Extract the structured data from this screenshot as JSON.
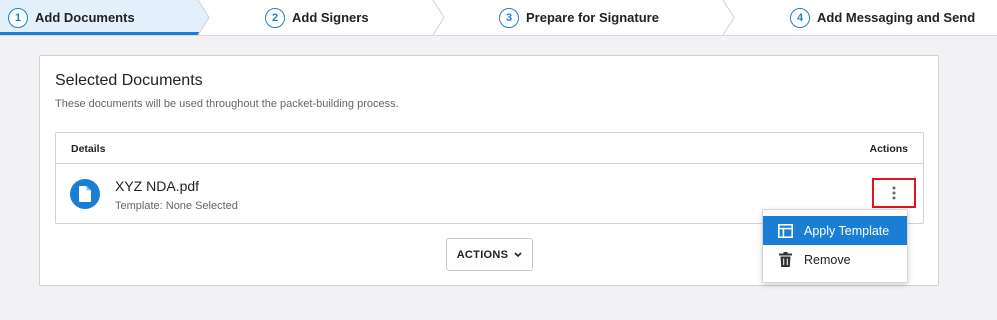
{
  "stepper": {
    "steps": [
      {
        "number": "1",
        "label": "Add Documents",
        "active": true
      },
      {
        "number": "2",
        "label": "Add Signers",
        "active": false
      },
      {
        "number": "3",
        "label": "Prepare for Signature",
        "active": false
      },
      {
        "number": "4",
        "label": "Add Messaging and Send",
        "active": false
      }
    ]
  },
  "card": {
    "title": "Selected Documents",
    "subtitle": "These documents will be used throughout the packet-building process.",
    "table": {
      "columns": {
        "details": "Details",
        "actions": "Actions"
      },
      "rows": [
        {
          "name": "XYZ NDA.pdf",
          "template": "Template: None Selected",
          "icon": "file-icon"
        }
      ]
    },
    "actions_button": "ACTIONS"
  },
  "menu": {
    "items": [
      {
        "label": "Apply Template",
        "icon": "template-icon",
        "highlighted": true
      },
      {
        "label": "Remove",
        "icon": "trash-icon",
        "highlighted": false
      }
    ]
  },
  "colors": {
    "accent": "#1a7fd4",
    "active_step_bg": "#e3f0fb",
    "highlight_border": "#e0141e",
    "page_bg": "#f2f2f5"
  }
}
